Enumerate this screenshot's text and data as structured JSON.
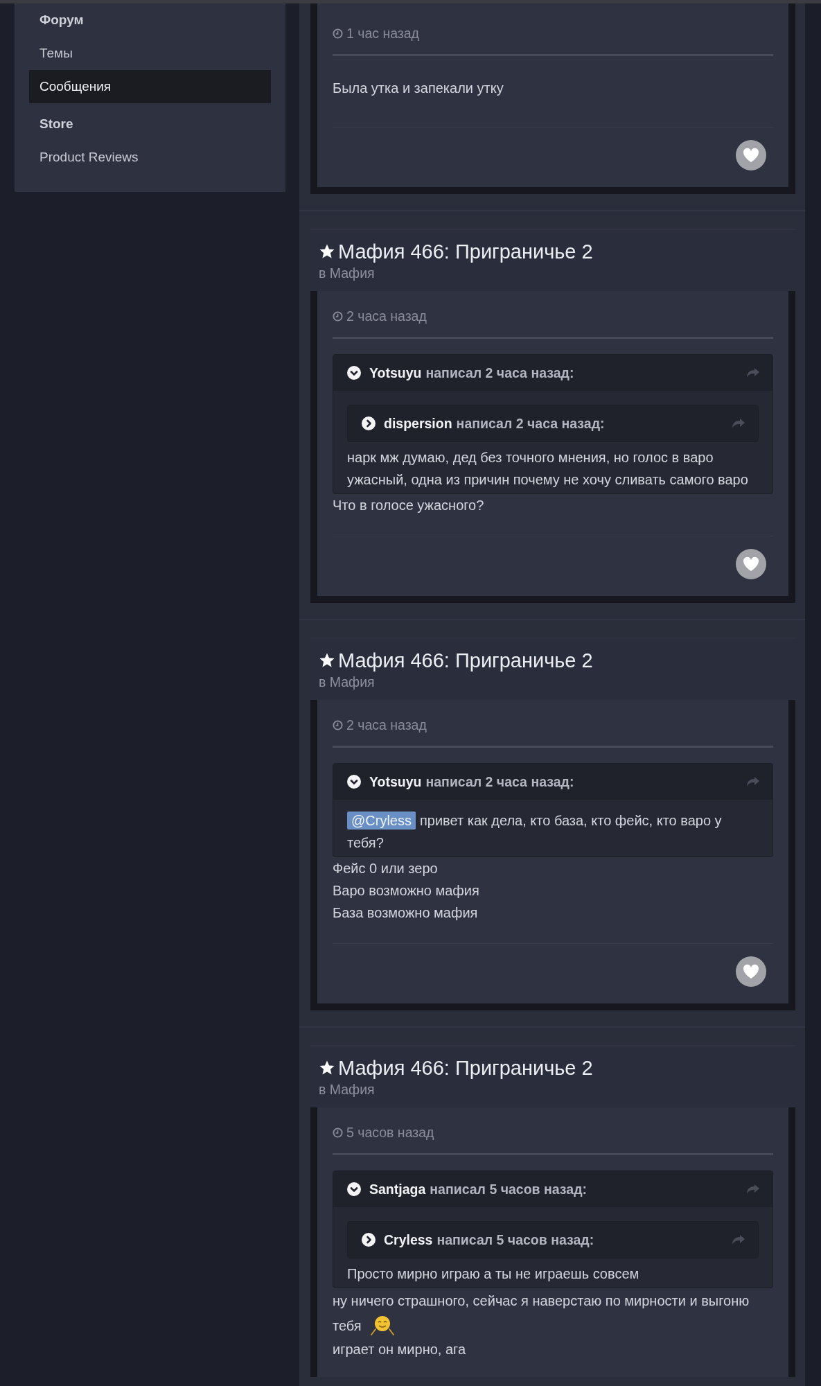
{
  "sidebar": {
    "items": [
      {
        "kind": "heading",
        "label": "Форум"
      },
      {
        "kind": "link",
        "label": "Темы",
        "selected": false
      },
      {
        "kind": "link",
        "label": "Сообщения",
        "selected": true
      },
      {
        "kind": "heading",
        "label": "Store"
      },
      {
        "kind": "link",
        "label": "Product Reviews",
        "selected": false
      }
    ]
  },
  "posts": [
    {
      "time": "1 час назад",
      "body": [
        {
          "text": "Была утка и запекали утку"
        }
      ]
    },
    {
      "title": "Мафия 466: Приграничье 2",
      "category": "в Мафия",
      "time": "2 часа назад",
      "quote": {
        "author": "Yotsuyu",
        "meta": "написал 2 часа назад:",
        "expanded": true,
        "quote": {
          "author": "dispersion",
          "meta": "написал 2 часа назад:",
          "expanded": false
        },
        "body": [
          {
            "text": "нарк мж думаю, дед без точного мнения, но голос в варо ужасный, одна из причин почему не хочу сливать самого варо"
          }
        ]
      },
      "body": [
        {
          "text": "Что в голосе ужасного?"
        }
      ]
    },
    {
      "title": "Мафия 466: Приграничье 2",
      "category": "в Мафия",
      "time": "2 часа назад",
      "quote": {
        "author": "Yotsuyu",
        "meta": "написал 2 часа назад:",
        "expanded": true,
        "body": [
          {
            "mention": "@Cryless",
            "text": "привет как дела, кто база, кто фейс, кто варо у тебя?"
          }
        ]
      },
      "body": [
        {
          "text": "Фейс 0 или зеро"
        },
        {
          "text": "Варо возможно мафия"
        },
        {
          "text": "База возможно мафия"
        }
      ]
    },
    {
      "title": "Мафия 466: Приграничье 2",
      "category": "в Мафия",
      "time": "5 часов назад",
      "quote": {
        "author": "Santjaga",
        "meta": "написал 5 часов назад:",
        "expanded": true,
        "quote": {
          "author": "Cryless",
          "meta": "написал 5 часов назад:",
          "expanded": false
        },
        "body": [
          {
            "text": "Просто мирно играю а ты не играешь совсем"
          }
        ]
      },
      "body": [
        {
          "text": "ну ничего страшного, сейчас я наверстаю по мирности и выгоню тебя",
          "emoji": true
        },
        {
          "text": "играет он мирно, ага"
        }
      ],
      "cut": true
    }
  ]
}
